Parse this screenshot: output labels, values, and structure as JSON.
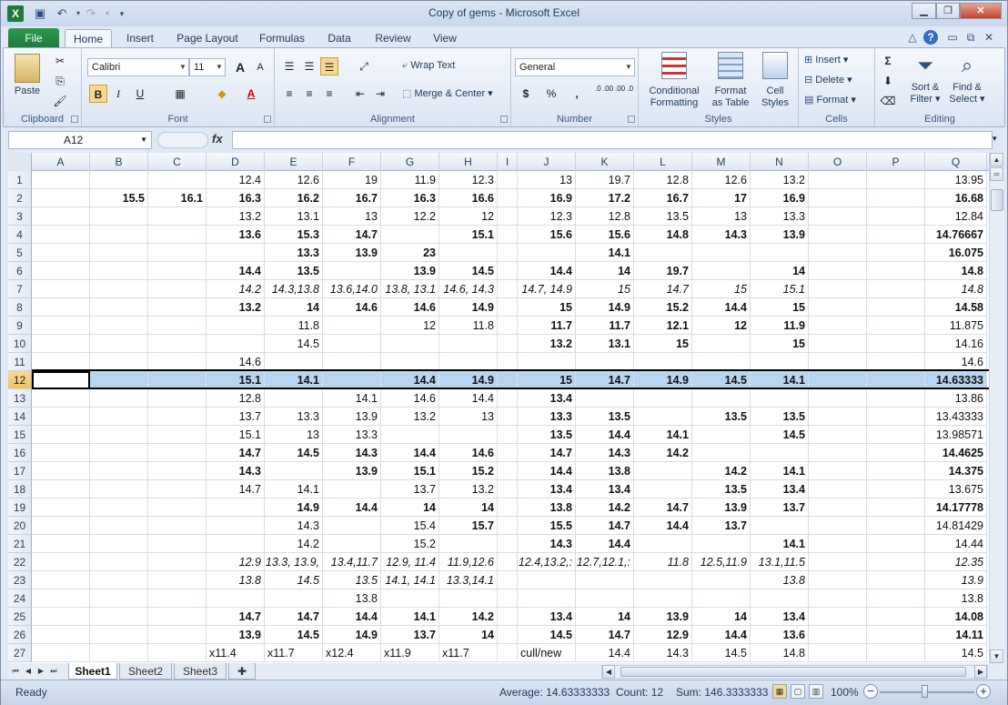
{
  "window": {
    "title": "Copy of gems - Microsoft Excel",
    "app_icon": "X"
  },
  "qat": {
    "save": "save-icon",
    "undo": "undo-icon",
    "redo": "redo-icon"
  },
  "tabs": [
    "File",
    "Home",
    "Insert",
    "Page Layout",
    "Formulas",
    "Data",
    "Review",
    "View"
  ],
  "ribbon": {
    "clipboard": {
      "label": "Clipboard",
      "paste": "Paste"
    },
    "font": {
      "label": "Font",
      "name": "Calibri",
      "size": "11",
      "bold": "B",
      "italic": "I",
      "underline": "U",
      "grow": "A",
      "shrink": "A"
    },
    "alignment": {
      "label": "Alignment",
      "wrap": "Wrap Text",
      "merge": "Merge & Center"
    },
    "number": {
      "label": "Number",
      "format": "General",
      "currency": "$",
      "percent": "%",
      "comma": ",",
      "inc": ".0 .00",
      "dec": ".00 .0"
    },
    "styles": {
      "label": "Styles",
      "cond1": "Conditional",
      "cond2": "Formatting",
      "fmt1": "Format",
      "fmt2": "as Table",
      "cell1": "Cell",
      "cell2": "Styles"
    },
    "cells": {
      "label": "Cells",
      "insert": "Insert",
      "delete": "Delete",
      "format": "Format"
    },
    "editing": {
      "label": "Editing",
      "sigma": "Σ",
      "sort1": "Sort &",
      "sort2": "Filter",
      "find1": "Find &",
      "find2": "Select"
    }
  },
  "formula_bar": {
    "name_box": "A12",
    "fx": "fx",
    "formula": ""
  },
  "columns": [
    "A",
    "B",
    "C",
    "D",
    "E",
    "F",
    "G",
    "H",
    "I",
    "J",
    "K",
    "L",
    "M",
    "N",
    "O",
    "P",
    "Q"
  ],
  "selected_row": 12,
  "rows": [
    {
      "n": "1",
      "s": "",
      "c": {
        "D": "12.4",
        "E": "12.6",
        "F": "19",
        "G": "11.9",
        "H": "12.3",
        "J": "13",
        "K": "19.7",
        "L": "12.8",
        "M": "12.6",
        "N": "13.2",
        "Q": "13.95"
      }
    },
    {
      "n": "2",
      "s": "b",
      "c": {
        "B": "15.5",
        "C": "16.1",
        "D": "16.3",
        "E": "16.2",
        "F": "16.7",
        "G": "16.3",
        "H": "16.6",
        "J": "16.9",
        "K": "17.2",
        "L": "16.7",
        "M": "17",
        "N": "16.9",
        "Q": "16.68"
      }
    },
    {
      "n": "3",
      "s": "",
      "c": {
        "D": "13.2",
        "E": "13.1",
        "F": "13",
        "G": "12.2",
        "H": "12",
        "J": "12.3",
        "K": "12.8",
        "L": "13.5",
        "M": "13",
        "N": "13.3",
        "Q": "12.84"
      }
    },
    {
      "n": "4",
      "s": "b",
      "c": {
        "D": "13.6",
        "E": "15.3",
        "F": "14.7",
        "H": "15.1",
        "J": "15.6",
        "K": "15.6",
        "L": "14.8",
        "M": "14.3",
        "N": "13.9",
        "Q": "14.76667"
      }
    },
    {
      "n": "5",
      "s": "b",
      "c": {
        "E": "13.3",
        "F": "13.9",
        "G": "23",
        "K": "14.1",
        "Q": "16.075"
      }
    },
    {
      "n": "6",
      "s": "b",
      "c": {
        "D": "14.4",
        "E": "13.5",
        "G": "13.9",
        "H": "14.5",
        "J": "14.4",
        "K": "14",
        "L": "19.7",
        "N": "14",
        "Q": "14.8"
      }
    },
    {
      "n": "7",
      "s": "i",
      "c": {
        "D": "14.2",
        "E": "14.3,13.8",
        "F": "13.6,14.0",
        "G": "13.8, 13.1",
        "H": "14.6, 14.3",
        "J": "14.7, 14.9",
        "K": "15",
        "L": "14.7",
        "M": "15",
        "N": "15.1",
        "Q": "14.8"
      }
    },
    {
      "n": "8",
      "s": "b",
      "c": {
        "D": "13.2",
        "E": "14",
        "F": "14.6",
        "G": "14.6",
        "H": "14.9",
        "J": "15",
        "K": "14.9",
        "L": "15.2",
        "M": "14.4",
        "N": "15",
        "Q": "14.58"
      }
    },
    {
      "n": "9",
      "s": "",
      "c": {
        "E": "11.8",
        "G": "12",
        "H": "11.8",
        "J": "11.7",
        "K": "11.7",
        "L": "12.1",
        "M": "12",
        "N": "11.9",
        "Q": "11.875"
      },
      "b": [
        "J",
        "K",
        "L",
        "M",
        "N"
      ]
    },
    {
      "n": "10",
      "s": "",
      "c": {
        "E": "14.5",
        "J": "13.2",
        "K": "13.1",
        "L": "15",
        "N": "15",
        "Q": "14.16"
      },
      "b": [
        "J",
        "K",
        "L",
        "N"
      ]
    },
    {
      "n": "11",
      "s": "",
      "c": {
        "D": "14.6",
        "Q": "14.6"
      }
    },
    {
      "n": "12",
      "s": "b",
      "c": {
        "D": "15.1",
        "E": "14.1",
        "G": "14.4",
        "H": "14.9",
        "J": "15",
        "K": "14.7",
        "L": "14.9",
        "M": "14.5",
        "N": "14.1",
        "Q": "14.63333"
      }
    },
    {
      "n": "13",
      "s": "",
      "c": {
        "D": "12.8",
        "F": "14.1",
        "G": "14.6",
        "H": "14.4",
        "J": "13.4",
        "Q": "13.86"
      },
      "b": [
        "J"
      ]
    },
    {
      "n": "14",
      "s": "",
      "c": {
        "D": "13.7",
        "E": "13.3",
        "F": "13.9",
        "G": "13.2",
        "H": "13",
        "J": "13.3",
        "K": "13.5",
        "M": "13.5",
        "N": "13.5",
        "Q": "13.43333"
      },
      "b": [
        "J",
        "K",
        "M",
        "N"
      ]
    },
    {
      "n": "15",
      "s": "",
      "c": {
        "D": "15.1",
        "E": "13",
        "F": "13.3",
        "J": "13.5",
        "K": "14.4",
        "L": "14.1",
        "N": "14.5",
        "Q": "13.98571"
      },
      "b": [
        "J",
        "K",
        "L",
        "N"
      ]
    },
    {
      "n": "16",
      "s": "b",
      "c": {
        "D": "14.7",
        "E": "14.5",
        "F": "14.3",
        "G": "14.4",
        "H": "14.6",
        "J": "14.7",
        "K": "14.3",
        "L": "14.2",
        "Q": "14.4625"
      }
    },
    {
      "n": "17",
      "s": "b",
      "c": {
        "D": "14.3",
        "F": "13.9",
        "G": "15.1",
        "H": "15.2",
        "J": "14.4",
        "K": "13.8",
        "M": "14.2",
        "N": "14.1",
        "Q": "14.375"
      }
    },
    {
      "n": "18",
      "s": "",
      "c": {
        "D": "14.7",
        "E": "14.1",
        "G": "13.7",
        "H": "13.2",
        "J": "13.4",
        "K": "13.4",
        "M": "13.5",
        "N": "13.4",
        "Q": "13.675"
      },
      "b": [
        "J",
        "K",
        "M",
        "N"
      ]
    },
    {
      "n": "19",
      "s": "b",
      "c": {
        "E": "14.9",
        "F": "14.4",
        "G": "14",
        "H": "14",
        "J": "13.8",
        "K": "14.2",
        "L": "14.7",
        "M": "13.9",
        "N": "13.7",
        "Q": "14.17778"
      }
    },
    {
      "n": "20",
      "s": "",
      "c": {
        "E": "14.3",
        "G": "15.4",
        "H": "15.7",
        "J": "15.5",
        "K": "14.7",
        "L": "14.4",
        "M": "13.7",
        "Q": "14.81429"
      },
      "b": [
        "H",
        "J",
        "K",
        "L",
        "M"
      ]
    },
    {
      "n": "21",
      "s": "",
      "c": {
        "E": "14.2",
        "G": "15.2",
        "J": "14.3",
        "K": "14.4",
        "N": "14.1",
        "Q": "14.44"
      },
      "b": [
        "J",
        "K",
        "N"
      ]
    },
    {
      "n": "22",
      "s": "i",
      "c": {
        "D": "12.9",
        "E": "13.3, 13.9,",
        "F": "13.4,11.7",
        "G": "12.9, 11.4",
        "H": "11.9,12.6",
        "J": "12.4,13.2,:",
        "K": "12.7,12.1,:",
        "L": "11.8",
        "M": "12.5,11.9",
        "N": "13.1,11.5",
        "Q": "12.35"
      }
    },
    {
      "n": "23",
      "s": "i",
      "c": {
        "D": "13.8",
        "E": "14.5",
        "F": "13.5",
        "G": "14.1, 14.1",
        "H": "13.3,14.1",
        "N": "13.8",
        "Q": "13.9"
      }
    },
    {
      "n": "24",
      "s": "",
      "c": {
        "F": "13.8",
        "Q": "13.8"
      }
    },
    {
      "n": "25",
      "s": "b",
      "c": {
        "D": "14.7",
        "E": "14.7",
        "F": "14.4",
        "G": "14.1",
        "H": "14.2",
        "J": "13.4",
        "K": "14",
        "L": "13.9",
        "M": "14",
        "N": "13.4",
        "Q": "14.08"
      }
    },
    {
      "n": "26",
      "s": "b",
      "c": {
        "D": "13.9",
        "E": "14.5",
        "F": "14.9",
        "G": "13.7",
        "H": "14",
        "J": "14.5",
        "K": "14.7",
        "L": "12.9",
        "M": "14.4",
        "N": "13.6",
        "Q": "14.11"
      }
    },
    {
      "n": "27",
      "s": "",
      "c": {
        "D": "x11.4",
        "E": "x11.7",
        "F": "x12.4",
        "G": "x11.9",
        "H": "x11.7",
        "J": "cull/new",
        "K": "14.4",
        "L": "14.3",
        "M": "14.5",
        "N": "14.8",
        "Q": "14.5"
      },
      "l": [
        "D",
        "E",
        "F",
        "G",
        "H",
        "J"
      ]
    }
  ],
  "sheets": [
    "Sheet1",
    "Sheet2",
    "Sheet3"
  ],
  "active_sheet": "Sheet1",
  "status": {
    "ready": "Ready",
    "average": "Average: 14.63333333",
    "count": "Count: 12",
    "sum": "Sum: 146.3333333",
    "zoom": "100%"
  }
}
